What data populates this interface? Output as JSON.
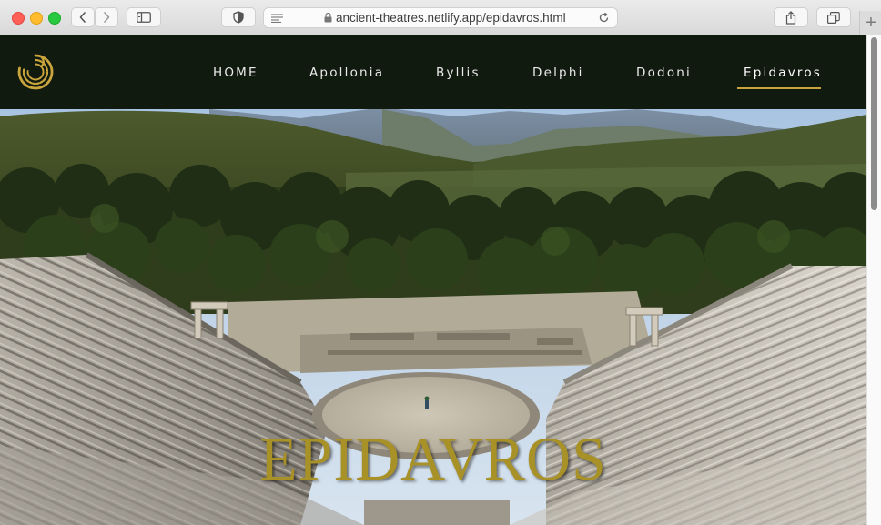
{
  "browser": {
    "url": "ancient-theatres.netlify.app/epidavros.html",
    "new_tab_label": "+"
  },
  "site": {
    "logo_icon": "theatre-spiral-logo",
    "nav": [
      {
        "label": "HOME",
        "active": false
      },
      {
        "label": "Apollonia",
        "active": false
      },
      {
        "label": "Byllis",
        "active": false
      },
      {
        "label": "Delphi",
        "active": false
      },
      {
        "label": "Dodoni",
        "active": false
      },
      {
        "label": "Epidavros",
        "active": true
      }
    ],
    "accent_color": "#c9a53c",
    "header_bg": "#111a0f"
  },
  "hero": {
    "title": "EPIDAVROS",
    "title_color": "#a89228"
  }
}
